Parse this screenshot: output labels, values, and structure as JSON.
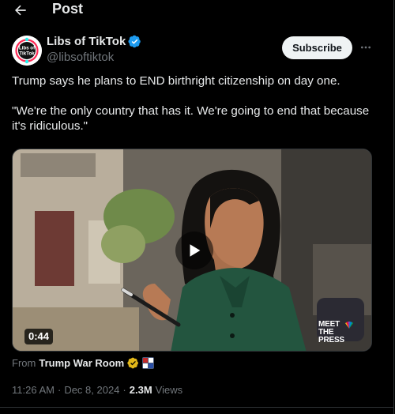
{
  "header": {
    "title": "Post"
  },
  "author": {
    "display_name": "Libs of TikTok",
    "handle": "@libsoftiktok",
    "avatar_text_line1": "Libs of",
    "avatar_text_line2": "TikTok",
    "verified": true
  },
  "actions": {
    "subscribe_label": "Subscribe"
  },
  "tweet": {
    "paragraph1": "Trump says he plans to END birthright citizenship on day one.",
    "paragraph2": "\"We're the only country that has it. We're going to end that because it's ridiculous.\""
  },
  "media": {
    "duration": "0:44",
    "watermark_line1": "MEET",
    "watermark_line2": "THE PRESS"
  },
  "source": {
    "from_label": "From",
    "name": "Trump War Room"
  },
  "meta": {
    "time": "11:26 AM",
    "separator": "·",
    "date": "Dec 8, 2024",
    "views_count": "2.3M",
    "views_label": "Views"
  },
  "colors": {
    "background": "#000000",
    "text_primary": "#e7e9ea",
    "text_secondary": "#71767b",
    "verified_blue": "#1d9bf0",
    "verified_gold": "#e2b719",
    "subscribe_bg": "#eff3f4",
    "border": "#2f3336"
  },
  "icons": {
    "back": "arrow-left-icon",
    "verified": "verified-badge-icon",
    "more": "more-horizontal-icon",
    "play": "play-icon",
    "affiliate": "affiliate-badge-icon"
  }
}
